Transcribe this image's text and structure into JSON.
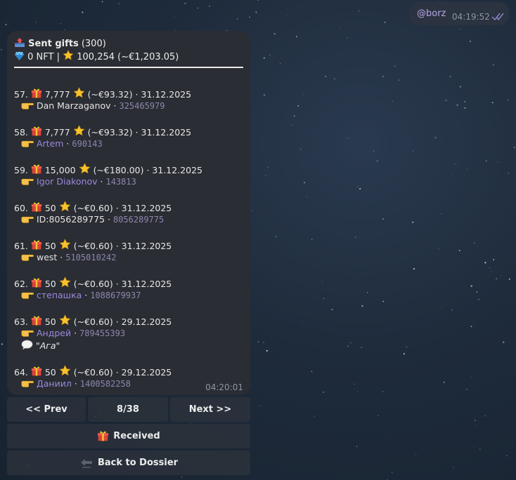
{
  "outgoing": {
    "mention": "@borz",
    "time": "04:19:52",
    "status_icon": "double-check-icon"
  },
  "message": {
    "title": "Sent gifts",
    "count": "(300)",
    "summary": {
      "nft": "0 NFT",
      "separator": " | ",
      "stars": "100,254",
      "eur": "(~€1,203.05)"
    },
    "time": "04:20:01",
    "entries": [
      {
        "num": "57.",
        "amount": "7,777",
        "eur": "(~€93.32)",
        "date": "· 31.12.2025",
        "name": "Dan Marzaganov",
        "name_link": false,
        "uid": "325465979",
        "comment": ""
      },
      {
        "num": "58.",
        "amount": "7,777",
        "eur": "(~€93.32)",
        "date": "· 31.12.2025",
        "name": "Artem",
        "name_link": true,
        "uid": "690143",
        "comment": ""
      },
      {
        "num": "59.",
        "amount": "15,000",
        "eur": "(~€180.00)",
        "date": "· 31.12.2025",
        "name": "Igor Diakonov",
        "name_link": true,
        "uid": "143813",
        "comment": ""
      },
      {
        "num": "60.",
        "amount": "50",
        "eur": "(~€0.60)",
        "date": "· 31.12.2025",
        "name": "ID:8056289775",
        "name_link": false,
        "uid": "8056289775",
        "comment": ""
      },
      {
        "num": "61.",
        "amount": "50",
        "eur": "(~€0.60)",
        "date": "· 31.12.2025",
        "name": "west",
        "name_link": false,
        "uid": "5105010242",
        "comment": ""
      },
      {
        "num": "62.",
        "amount": "50",
        "eur": "(~€0.60)",
        "date": "· 31.12.2025",
        "name": "степашка",
        "name_link": true,
        "uid": "1088679937",
        "comment": ""
      },
      {
        "num": "63.",
        "amount": "50",
        "eur": "(~€0.60)",
        "date": "· 29.12.2025",
        "name": "Андрей",
        "name_link": true,
        "uid": "789455393",
        "comment": "Ага"
      },
      {
        "num": "64.",
        "amount": "50",
        "eur": "(~€0.60)",
        "date": "· 29.12.2025",
        "name": "Даниил",
        "name_link": true,
        "uid": "1400582258",
        "comment": ""
      }
    ]
  },
  "keyboard": {
    "prev": "<< Prev",
    "page": "8/38",
    "next": "Next >>",
    "received": "Received",
    "back": "Back to Dossier"
  },
  "colors": {
    "bubble": "#2a2d33",
    "link": "#9a88dd",
    "uid": "#8d86b0",
    "time": "#8c97a3"
  }
}
